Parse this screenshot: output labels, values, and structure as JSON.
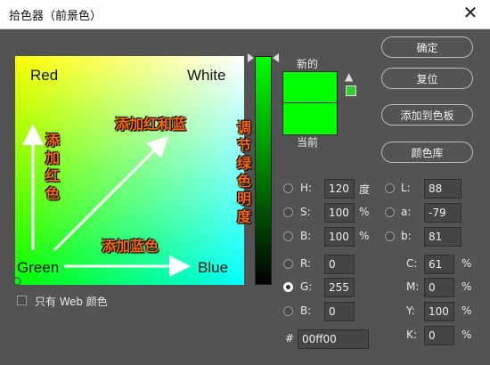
{
  "window": {
    "title": "拾色器（前景色）",
    "close_glyph": "✕"
  },
  "field": {
    "corner_labels": {
      "top_left": "Red",
      "top_right": "White",
      "bottom_left": "Green",
      "bottom_right": "Blue"
    },
    "annotations": {
      "add_red_blue": "添加红和蓝",
      "add_red": "添加红色",
      "add_blue": "添加蓝色",
      "green_lightness": "调节绿色明度"
    }
  },
  "swatches": {
    "new_label": "新的",
    "current_label": "当前",
    "new_color": "#00ff00",
    "current_color": "#00ff00",
    "warning_glyph": "▲"
  },
  "buttons": {
    "ok": "确定",
    "reset": "复位",
    "add_to_swatches": "添加到色板",
    "color_libraries": "颜色库"
  },
  "hsb": {
    "h": {
      "label": "H:",
      "value": "120",
      "unit": "度"
    },
    "s": {
      "label": "S:",
      "value": "100",
      "unit": "%"
    },
    "b": {
      "label": "B:",
      "value": "100",
      "unit": "%"
    }
  },
  "lab": {
    "l": {
      "label": "L:",
      "value": "88"
    },
    "a": {
      "label": "a:",
      "value": "-79"
    },
    "b": {
      "label": "b:",
      "value": "81"
    }
  },
  "rgb": {
    "r": {
      "label": "R:",
      "value": "0"
    },
    "g": {
      "label": "G:",
      "value": "255"
    },
    "b": {
      "label": "B:",
      "value": "0"
    }
  },
  "cmyk": {
    "c": {
      "label": "C:",
      "value": "61",
      "unit": "%"
    },
    "m": {
      "label": "M:",
      "value": "0",
      "unit": "%"
    },
    "y": {
      "label": "Y:",
      "value": "100",
      "unit": "%"
    },
    "k": {
      "label": "K:",
      "value": "0",
      "unit": "%"
    }
  },
  "hex": {
    "label": "#",
    "value": "00ff00"
  },
  "web_only": {
    "label": "只有 Web 颜色",
    "checked": false
  },
  "selected_mode": "G"
}
